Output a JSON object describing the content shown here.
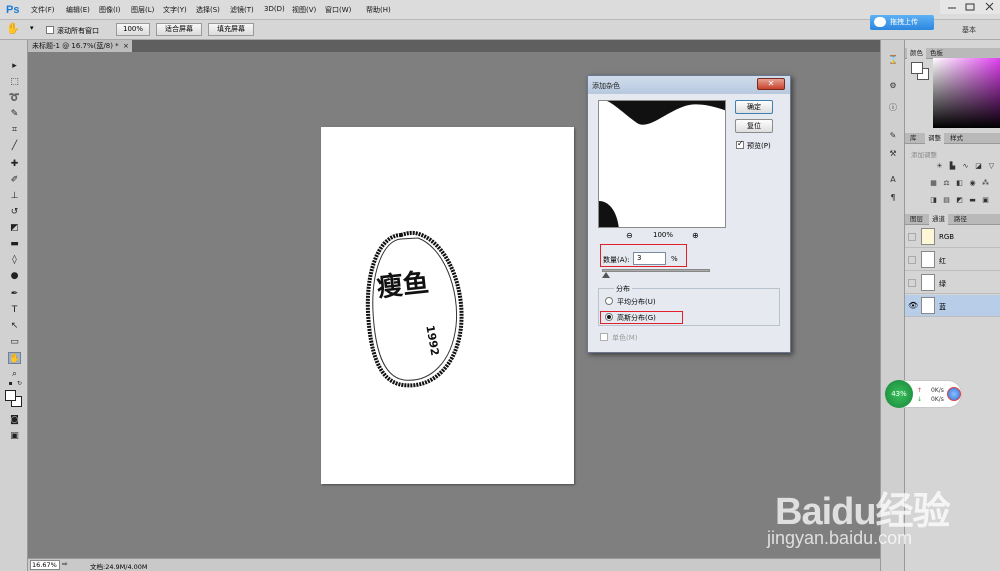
{
  "app": {
    "logo": "Ps"
  },
  "menu": [
    "文件(F)",
    "编辑(E)",
    "图像(I)",
    "图层(L)",
    "文字(Y)",
    "选择(S)",
    "滤镜(T)",
    "3D(D)",
    "视图(V)",
    "窗口(W)",
    "帮助(H)"
  ],
  "upload_button": "拖拽上传",
  "workspace": "基本",
  "options": {
    "scroll_all_windows": "滚动所有窗口",
    "zoom_value": "100%",
    "fit_screen": "适合屏幕",
    "fill_screen": "填充屏幕"
  },
  "document_tab": "未标题-1 @ 16.7%(蓝/8) *",
  "dialog": {
    "title": "添加杂色",
    "ok": "确定",
    "reset": "复位",
    "preview": "预览(P)",
    "zoom": "100%",
    "amount_label": "数量(A):",
    "amount_value": "3",
    "amount_unit": "%",
    "amount_percent": 3,
    "distribution_title": "分布",
    "uniform": "平均分布(U)",
    "gaussian": "高斯分布(G)",
    "selected_distribution": "gaussian",
    "monochromatic": "单色(M)"
  },
  "panels": {
    "color_tabs": [
      "颜色",
      "色板"
    ],
    "adjust_tabs": [
      "库",
      "调整",
      "样式"
    ],
    "adjust_label": "添加调整",
    "channel_tabs": [
      "图层",
      "通道",
      "路径"
    ],
    "channels": [
      {
        "name": "RGB",
        "visible": false,
        "selected": false
      },
      {
        "name": "红",
        "visible": false,
        "selected": false
      },
      {
        "name": "绿",
        "visible": false,
        "selected": false
      },
      {
        "name": "蓝",
        "visible": true,
        "selected": true
      }
    ]
  },
  "speed_widget": {
    "percent": "43%",
    "up": "0K/s",
    "down": "0K/s"
  },
  "status": {
    "zoom": "16.67%",
    "doc_info": "文档:24.9M/4.00M"
  },
  "artwork": {
    "text_main": "瘦鱼",
    "text_year": "1992"
  },
  "watermark": {
    "brand": "Baidu经验",
    "url": "jingyan.baidu.com"
  }
}
